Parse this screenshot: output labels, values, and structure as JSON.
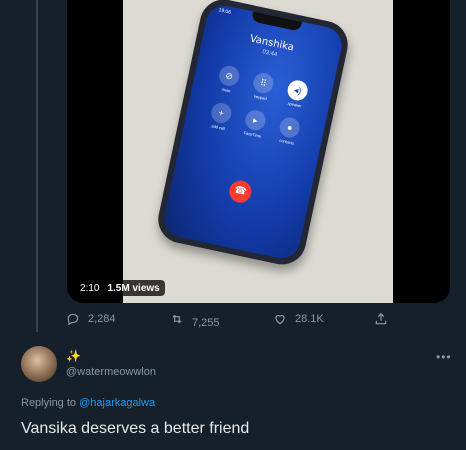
{
  "video": {
    "duration": "2:10",
    "views": "1.5M views",
    "screen": {
      "status_time": "19:06",
      "caller_name": "Vanshika",
      "call_duration": "03:44",
      "buttons": [
        {
          "label": "mute",
          "icon": "mic-off-icon"
        },
        {
          "label": "keypad",
          "icon": "keypad-icon"
        },
        {
          "label": "speaker",
          "icon": "speaker-icon"
        },
        {
          "label": "add call",
          "icon": "plus-icon"
        },
        {
          "label": "FaceTime",
          "icon": "video-icon"
        },
        {
          "label": "contacts",
          "icon": "contact-icon"
        }
      ]
    }
  },
  "actions": {
    "replies": "2,284",
    "retweets": "7,255",
    "likes": "28.1K"
  },
  "reply": {
    "display_name_emoji": "✨",
    "handle": "@watermeowwlon",
    "replying_prefix": "Replying to",
    "replying_to": "@hajarkagalwa",
    "text": "Vansika deserves a better friend"
  },
  "colors": {
    "background": "#15202b",
    "secondary_text": "#8b98a5",
    "link": "#1d9bf0"
  }
}
